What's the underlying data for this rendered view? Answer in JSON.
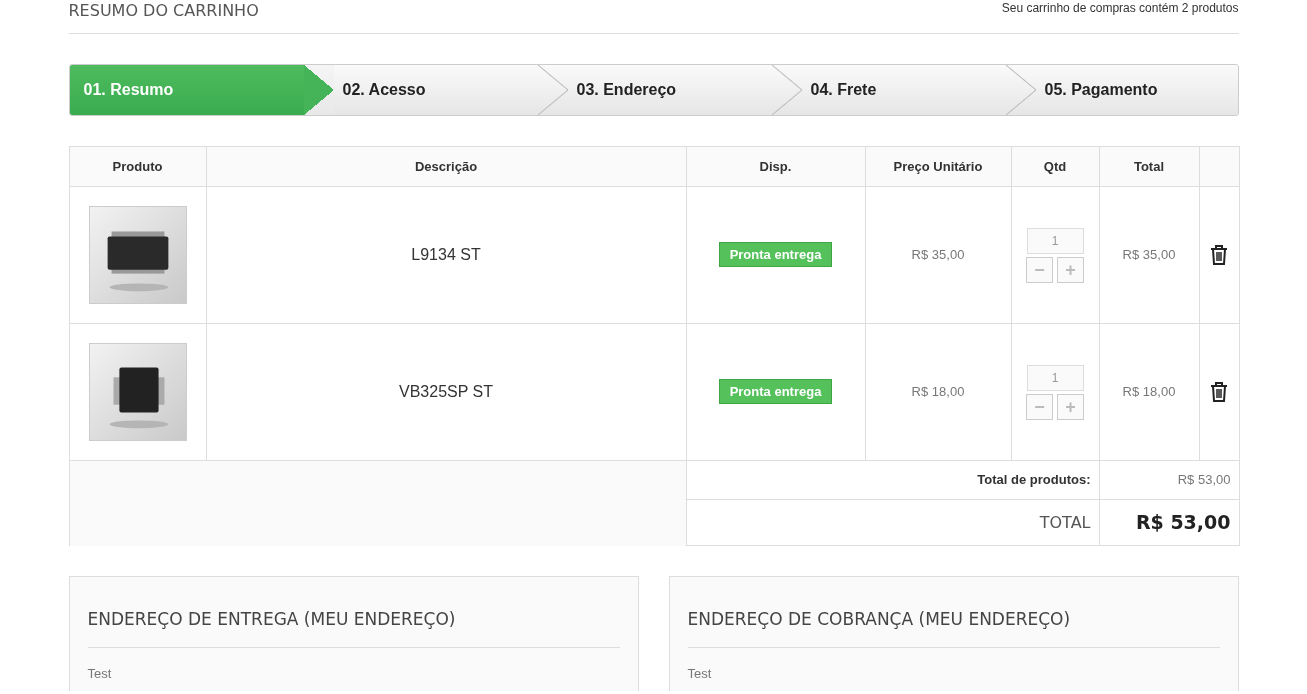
{
  "header": {
    "title": "RESUMO DO CARRINHO",
    "summary": "Seu carrinho de compras contém 2 produtos"
  },
  "steps": [
    {
      "label": "01. Resumo",
      "selected": true
    },
    {
      "label": "02. Acesso",
      "selected": false
    },
    {
      "label": "03. Endereço",
      "selected": false
    },
    {
      "label": "04. Frete",
      "selected": false
    },
    {
      "label": "05. Pagamento",
      "selected": false
    }
  ],
  "table": {
    "columns": [
      "Produto",
      "Descrição",
      "Disp.",
      "Preço Unitário",
      "Qtd",
      "Total"
    ],
    "rows": [
      {
        "description": "L9134 ST",
        "availability": "Pronta entrega",
        "unit_price": "R$ 35,00",
        "quantity": "1",
        "decrease": "−",
        "increase": "+",
        "total": "R$ 35,00"
      },
      {
        "description": "VB325SP ST",
        "availability": "Pronta entrega",
        "unit_price": "R$ 18,00",
        "quantity": "1",
        "decrease": "−",
        "increase": "+",
        "total": "R$ 18,00"
      }
    ],
    "subtotal_label": "Total de produtos:",
    "subtotal": "R$ 53,00",
    "total_label": "TOTAL",
    "total": "R$ 53,00"
  },
  "addresses": [
    {
      "title": "ENDEREÇO DE ENTREGA (MEU ENDEREÇO)",
      "line": "Test"
    },
    {
      "title": "ENDEREÇO DE COBRANÇA (MEU ENDEREÇO)",
      "line": "Test"
    }
  ]
}
